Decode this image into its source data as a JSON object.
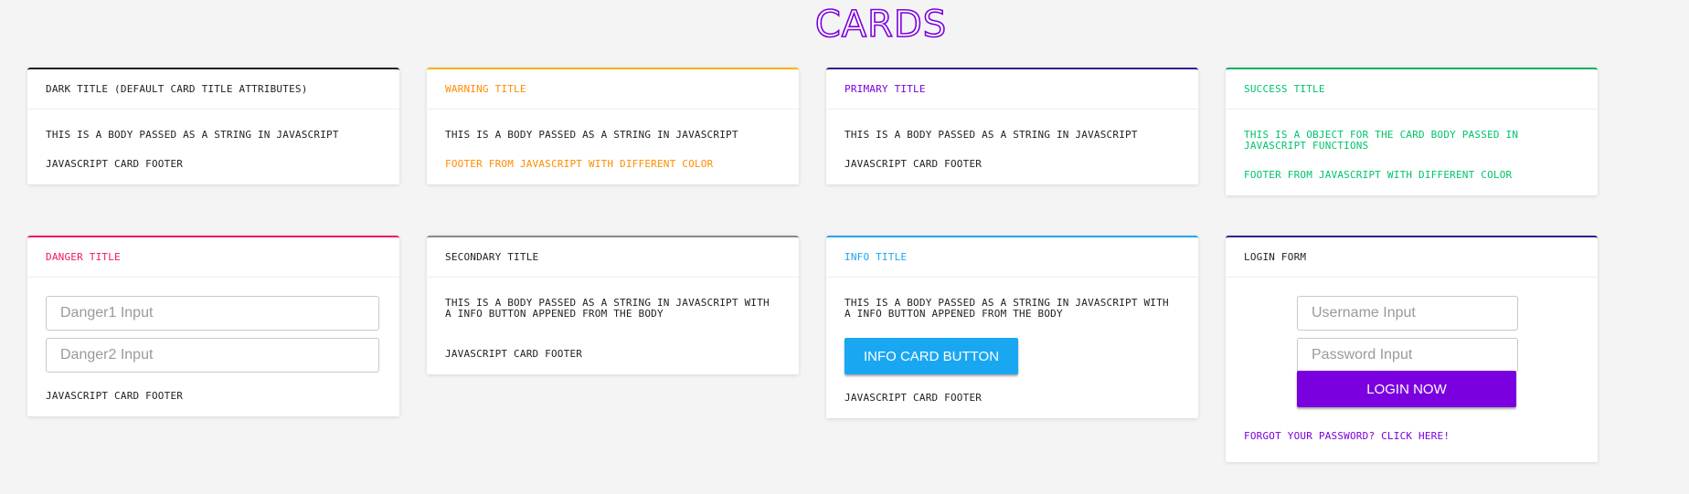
{
  "page": {
    "title": "Cards"
  },
  "colors": {
    "dark": "#222222",
    "warning": "#ff8c00",
    "primary": "#7b00e0",
    "success": "#00c46a",
    "danger": "#f0185c",
    "secondary": "#888888",
    "info": "#1aa7f2",
    "login_border": "#3a1d8a"
  },
  "cards": {
    "dark": {
      "title": "Dark Title (Default card title attributes)",
      "body": "This is a body passed as a string in javascript",
      "footer": "javascript card footer"
    },
    "warning": {
      "title": "Warning Title",
      "body": "This is a body passed as a string in javascript",
      "footer": "Footer from javascript with different color"
    },
    "primary": {
      "title": "Primary Title",
      "body": "This is a body passed as a string in javascript",
      "footer": "javascript card footer"
    },
    "success": {
      "title": "Success Title",
      "body": "This is a object for the card body passed in javascript functions",
      "footer": "Footer from javascript with different color"
    },
    "danger": {
      "title": "Danger Title",
      "input1_placeholder": "Danger1 Input",
      "input2_placeholder": "Danger2 Input",
      "footer": "javascript card footer"
    },
    "secondary": {
      "title": "Secondary Title",
      "body": "This is a body passed as a string in javascript with a info button appened from the body",
      "footer": "javascript card footer"
    },
    "info": {
      "title": "Info Title",
      "body": "This is a body passed as a string in javascript with a info button appened from the body",
      "button_label": "Info card button",
      "footer": "javascript card footer"
    },
    "login": {
      "title": "Login Form",
      "username_placeholder": "Username Input",
      "password_placeholder": "Password Input",
      "button_label": "Login now",
      "forgot_link": "Forgot your password? Click here!"
    }
  }
}
